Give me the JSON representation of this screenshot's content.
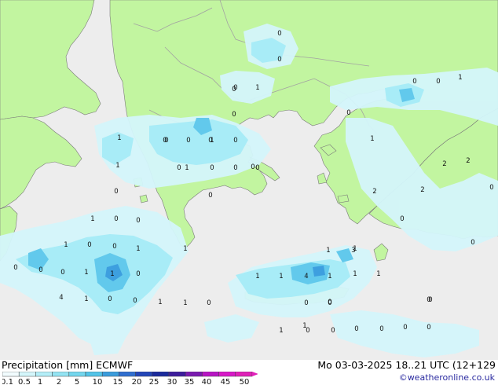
{
  "footer": {
    "title": "Precipitation [mm]  ECMWF",
    "datetime": "Mo 03-03-2025 18..21 UTC (12+129",
    "credit": "©weatheronline.co.uk"
  },
  "legend": {
    "labels": [
      "0.1",
      "0.5",
      "1",
      "2",
      "5",
      "10",
      "15",
      "20",
      "25",
      "30",
      "35",
      "40",
      "45",
      "50"
    ],
    "colors": [
      "#f2fcfe",
      "#d4f6fb",
      "#b4eef8",
      "#94e4f3",
      "#74d7ee",
      "#52c4e8",
      "#3a9cdc",
      "#2f6ed0",
      "#2245b8",
      "#1a2a9c",
      "#3c1c9c",
      "#7a1ab0",
      "#b814c4",
      "#d818c8",
      "#e020b8"
    ]
  },
  "map_colors": {
    "sea": "#ededed",
    "land": "#c2f5a0",
    "border": "#a2a2a2",
    "coast": "#7a7a7a",
    "rain_light": "#d4f6fb",
    "rain_mid": "#a8ecf7",
    "rain_heavy": "#62c9ec",
    "rain_core": "#3d9fdf"
  },
  "precip_values": [
    {
      "v": "0"
    },
    {
      "v": "0"
    },
    {
      "v": "0"
    },
    {
      "v": "1"
    },
    {
      "v": "0"
    },
    {
      "v": "1"
    },
    {
      "v": "0"
    },
    {
      "v": "0"
    },
    {
      "v": "1"
    },
    {
      "v": "0"
    },
    {
      "v": "1"
    },
    {
      "v": "0"
    },
    {
      "v": "0"
    },
    {
      "v": "1"
    },
    {
      "v": "0"
    },
    {
      "v": "0"
    },
    {
      "v": "1"
    },
    {
      "v": "0"
    },
    {
      "v": "0"
    },
    {
      "v": "0"
    },
    {
      "v": "1"
    },
    {
      "v": "0"
    },
    {
      "v": "0"
    },
    {
      "v": "1"
    },
    {
      "v": "1"
    },
    {
      "v": "0"
    },
    {
      "v": "0"
    },
    {
      "v": "0"
    },
    {
      "v": "1"
    },
    {
      "v": "1"
    },
    {
      "v": "0"
    },
    {
      "v": "1"
    },
    {
      "v": "1"
    },
    {
      "v": "4"
    },
    {
      "v": "1"
    },
    {
      "v": "1"
    },
    {
      "v": "1"
    },
    {
      "v": "1"
    },
    {
      "v": "1"
    },
    {
      "v": "4"
    },
    {
      "v": "1"
    },
    {
      "v": "0"
    },
    {
      "v": "0"
    },
    {
      "v": "1"
    },
    {
      "v": "1"
    },
    {
      "v": "0"
    },
    {
      "v": "0"
    },
    {
      "v": "0"
    },
    {
      "v": "3"
    },
    {
      "v": "0"
    },
    {
      "v": "1"
    },
    {
      "v": "2"
    },
    {
      "v": "2"
    },
    {
      "v": "2"
    },
    {
      "v": "2"
    },
    {
      "v": "0"
    },
    {
      "v": "0"
    },
    {
      "v": "0"
    },
    {
      "v": "0"
    },
    {
      "v": "0"
    },
    {
      "v": "1"
    },
    {
      "v": "0"
    },
    {
      "v": "0"
    },
    {
      "v": "0"
    },
    {
      "v": "0"
    },
    {
      "v": "0"
    },
    {
      "v": "0"
    },
    {
      "v": "0"
    },
    {
      "v": "1"
    },
    {
      "v": "0"
    },
    {
      "v": "1"
    },
    {
      "v": "0"
    },
    {
      "v": "0"
    },
    {
      "v": "0"
    },
    {
      "v": "0"
    },
    {
      "v": "0"
    },
    {
      "v": "0"
    }
  ]
}
